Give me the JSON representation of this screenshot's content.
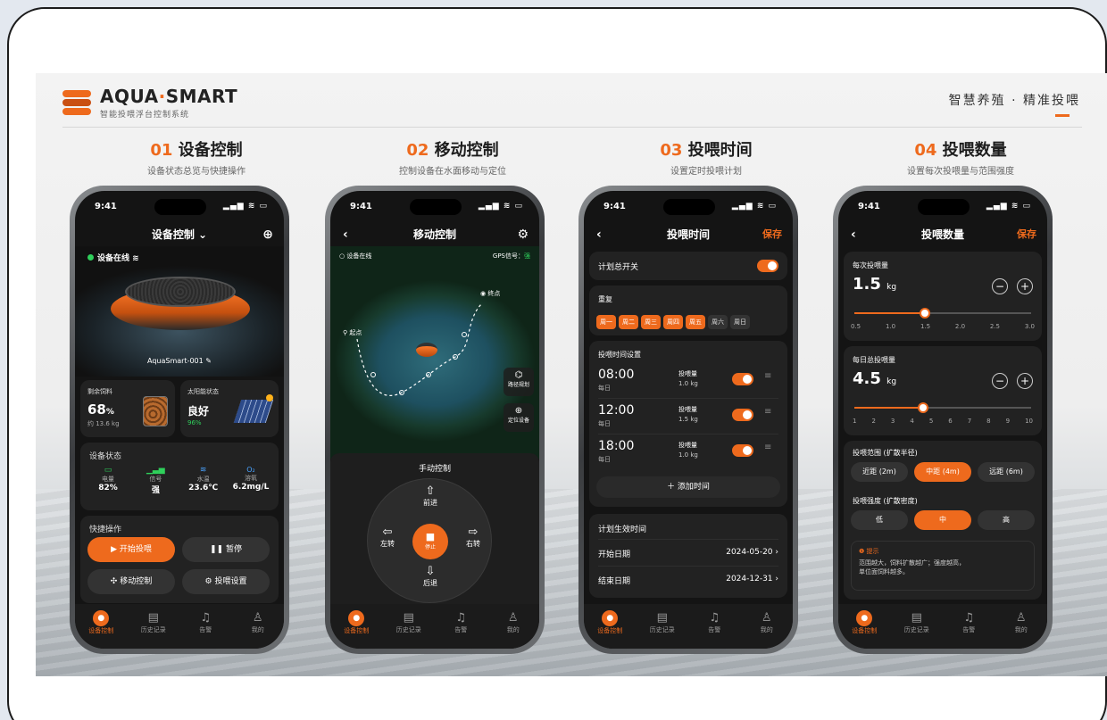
{
  "brand": {
    "prefix": "AQUA",
    "dot": "·",
    "suffix": "SMART",
    "subtitle": "智能投喂浮台控制系统",
    "slogan": "智慧养殖 · 精准投喂"
  },
  "columns": [
    {
      "num": "01",
      "title": "设备控制",
      "subtitle": "设备状态总览与快捷操作"
    },
    {
      "num": "02",
      "title": "移动控制",
      "subtitle": "控制设备在水面移动与定位"
    },
    {
      "num": "03",
      "title": "投喂时间",
      "subtitle": "设置定时投喂计划"
    },
    {
      "num": "04",
      "title": "投喂数量",
      "subtitle": "设置每次投喂量与范围强度"
    }
  ],
  "status_time": "9:41",
  "status_right": "▂▄▆ ≋ ▭",
  "tabs": [
    {
      "label": "设备控制",
      "icon": "●"
    },
    {
      "label": "历史记录",
      "icon": "▤"
    },
    {
      "label": "告警",
      "icon": "♫"
    },
    {
      "label": "我的",
      "icon": "♙"
    }
  ],
  "p1": {
    "title": "设备控制 ⌄",
    "add_icon": "⊕",
    "online": "设备在线 ≋",
    "device_name": "AquaSmart-001 ✎",
    "feed": {
      "label": "剩余饲料",
      "value": "68",
      "unit": "%",
      "sub": "约 13.6 kg"
    },
    "solar": {
      "label": "太阳能状态",
      "value": "良好",
      "sub": "96%"
    },
    "status_title": "设备状态",
    "metrics": [
      {
        "icon": "▭",
        "label": "电量",
        "value": "82%"
      },
      {
        "icon": "▁▃▅",
        "label": "信号",
        "value": "强"
      },
      {
        "icon": "≋",
        "label": "水温",
        "value": "23.6℃"
      },
      {
        "icon": "O₂",
        "label": "溶氧",
        "value": "6.2mg/L"
      }
    ],
    "quick_title": "快捷操作",
    "btn_start": "▶  开始投喂",
    "btn_pause": "❚❚  暂停",
    "btn_move": "✣  移动控制",
    "btn_settings": "⚙  投喂设置"
  },
  "p2": {
    "title": "移动控制",
    "online": "○ 设备在线",
    "gps_label": "GPS信号：",
    "gps_value": "强",
    "start": "起点",
    "end": "终点",
    "path_plan": "路径规划",
    "locate": "定位设备",
    "manual": "手动控制",
    "forward": "前进",
    "back": "后退",
    "left": "左转",
    "right": "右转",
    "stop": "停止"
  },
  "p3": {
    "title": "投喂时间",
    "save": "保存",
    "master": "计划总开关",
    "repeat": "重复",
    "days": [
      {
        "label": "周一",
        "on": true
      },
      {
        "label": "周二",
        "on": true
      },
      {
        "label": "周三",
        "on": true
      },
      {
        "label": "周四",
        "on": true
      },
      {
        "label": "周五",
        "on": true
      },
      {
        "label": "周六",
        "on": false
      },
      {
        "label": "周日",
        "on": false
      }
    ],
    "time_settings": "投喂时间设置",
    "times": [
      {
        "time": "08:00",
        "freq": "每日",
        "qty_label": "投喂量",
        "qty": "1.0 kg"
      },
      {
        "time": "12:00",
        "freq": "每日",
        "qty_label": "投喂量",
        "qty": "1.5 kg"
      },
      {
        "time": "18:00",
        "freq": "每日",
        "qty_label": "投喂量",
        "qty": "1.0 kg"
      }
    ],
    "add_time": "＋  添加时间",
    "valid": "计划生效时间",
    "start_label": "开始日期",
    "start_date": "2024-05-20  ›",
    "end_label": "结束日期",
    "end_date": "2024-12-31  ›"
  },
  "p4": {
    "title": "投喂数量",
    "save": "保存",
    "per": {
      "label": "每次投喂量",
      "value": "1.5",
      "unit": "kg",
      "ticks": [
        "0.5",
        "1.0",
        "1.5",
        "2.0",
        "2.5",
        "3.0"
      ],
      "min": 0.5,
      "max": 3.0,
      "current": 1.5
    },
    "daily": {
      "label": "每日总投喂量",
      "value": "4.5",
      "unit": "kg",
      "ticks": [
        "1",
        "2",
        "3",
        "4",
        "5",
        "6",
        "7",
        "8",
        "9",
        "10"
      ],
      "min": 1,
      "max": 10,
      "current": 4.5
    },
    "range_label": "投喂范围 (扩散半径)",
    "ranges": [
      {
        "label": "近距 (2m)",
        "on": false
      },
      {
        "label": "中距 (4m)",
        "on": true
      },
      {
        "label": "远距 (6m)",
        "on": false
      }
    ],
    "intensity_label": "投喂强度 (扩散密度)",
    "intensities": [
      {
        "label": "低",
        "on": false
      },
      {
        "label": "中",
        "on": true
      },
      {
        "label": "高",
        "on": false
      }
    ],
    "tip_title": "❶ 提示",
    "tip_line1": "范围越大，饲料扩散越广；强度越高，",
    "tip_line2": "单位面饲料越多。"
  },
  "colors": {
    "accent": "#ee6a1d",
    "good": "#2fd05b",
    "panel": "#222222"
  }
}
